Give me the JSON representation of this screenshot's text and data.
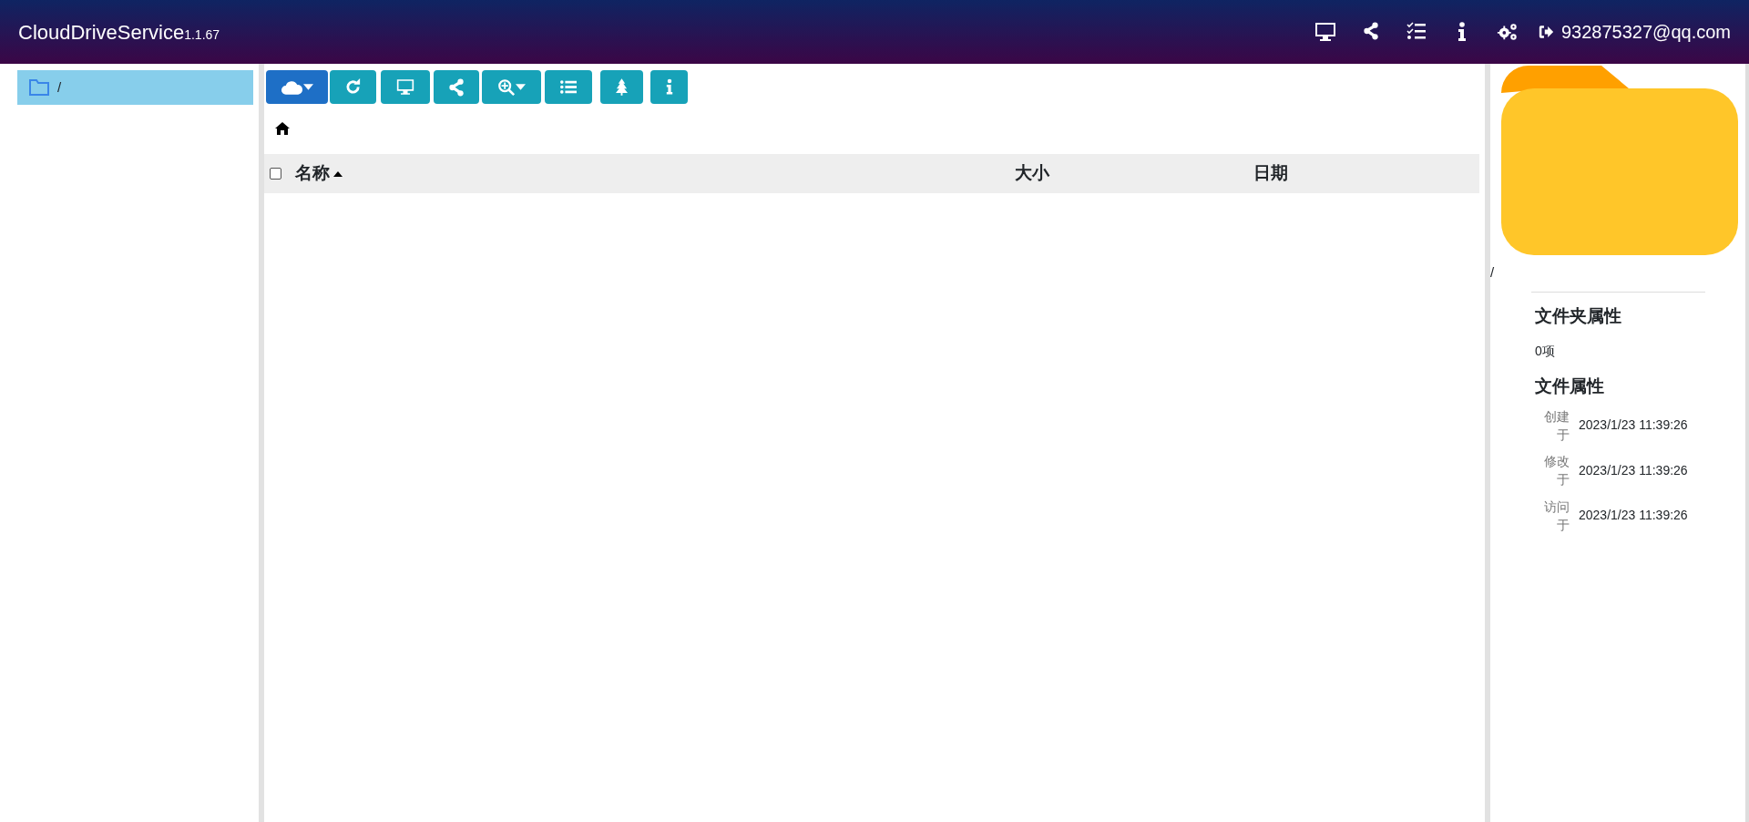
{
  "app": {
    "title": "CloudDriveService",
    "version": "1.1.67"
  },
  "user": {
    "email": "932875327@qq.com"
  },
  "tree": [
    {
      "label": "/",
      "selected": true
    }
  ],
  "table": {
    "select_all": {
      "checked": false
    },
    "columns": [
      {
        "label": "名称",
        "sorted": true
      },
      {
        "label": "大小",
        "sorted": false
      },
      {
        "label": "日期",
        "sorted": false
      }
    ]
  },
  "details": {
    "path": "/",
    "folder_heading": "文件夹属性",
    "item_count": "0项",
    "file_heading": "文件属性",
    "properties": [
      {
        "label": "创建于",
        "value": "2023/1/23 11:39:26"
      },
      {
        "label": "修改于",
        "value": "2023/1/23 11:39:26"
      },
      {
        "label": "访问于",
        "value": "2023/1/23 11:39:26"
      }
    ]
  }
}
